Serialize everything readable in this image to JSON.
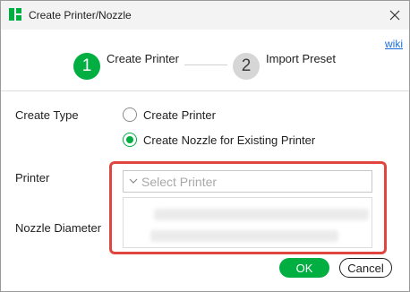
{
  "window": {
    "title": "Create Printer/Nozzle",
    "close_icon": "close-icon"
  },
  "links": {
    "wiki": "wiki"
  },
  "steps": [
    {
      "number": "1",
      "label": "Create Printer",
      "active": true
    },
    {
      "number": "2",
      "label": "Import Preset",
      "active": false
    }
  ],
  "form": {
    "create_type_label": "Create Type",
    "options": [
      {
        "label": "Create Printer",
        "checked": false
      },
      {
        "label": "Create Nozzle for Existing Printer",
        "checked": true
      }
    ],
    "printer_label": "Printer",
    "printer_placeholder": "Select Printer",
    "nozzle_diameter_label": "Nozzle Diameter"
  },
  "buttons": {
    "ok": "OK",
    "cancel": "Cancel"
  },
  "colors": {
    "accent": "#00ae42",
    "highlight": "#e0463f",
    "link": "#1a6ee0"
  }
}
